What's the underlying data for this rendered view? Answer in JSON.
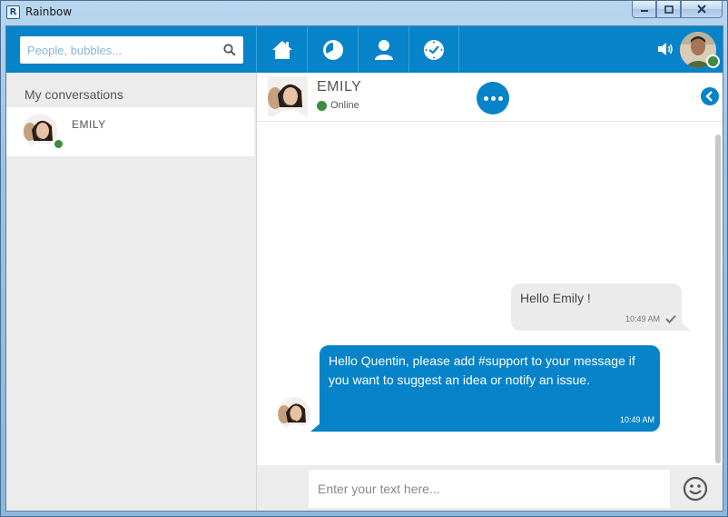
{
  "window": {
    "title": "Rainbow",
    "app_icon_letter": "R"
  },
  "search": {
    "placeholder": "People, bubbles..."
  },
  "nav": [
    {
      "name": "home"
    },
    {
      "name": "recents"
    },
    {
      "name": "contacts"
    },
    {
      "name": "activity"
    }
  ],
  "sidebar": {
    "title": "My conversations",
    "conversations": [
      {
        "name": "EMILY",
        "status": "online"
      }
    ]
  },
  "chat": {
    "contact_name": "EMILY",
    "contact_status": "Online",
    "messages": [
      {
        "direction": "out",
        "text": "Hello Emily !",
        "time": "10:49 AM",
        "read": true
      },
      {
        "direction": "in",
        "text": "Hello Quentin, please add #support to your message if you want to suggest an idea or notify an issue.",
        "time": "10:49 AM"
      }
    ]
  },
  "composer": {
    "placeholder": "Enter your text here..."
  },
  "colors": {
    "accent": "#0683c9",
    "online": "#3d8b3d",
    "panel_bg": "#ececec"
  }
}
